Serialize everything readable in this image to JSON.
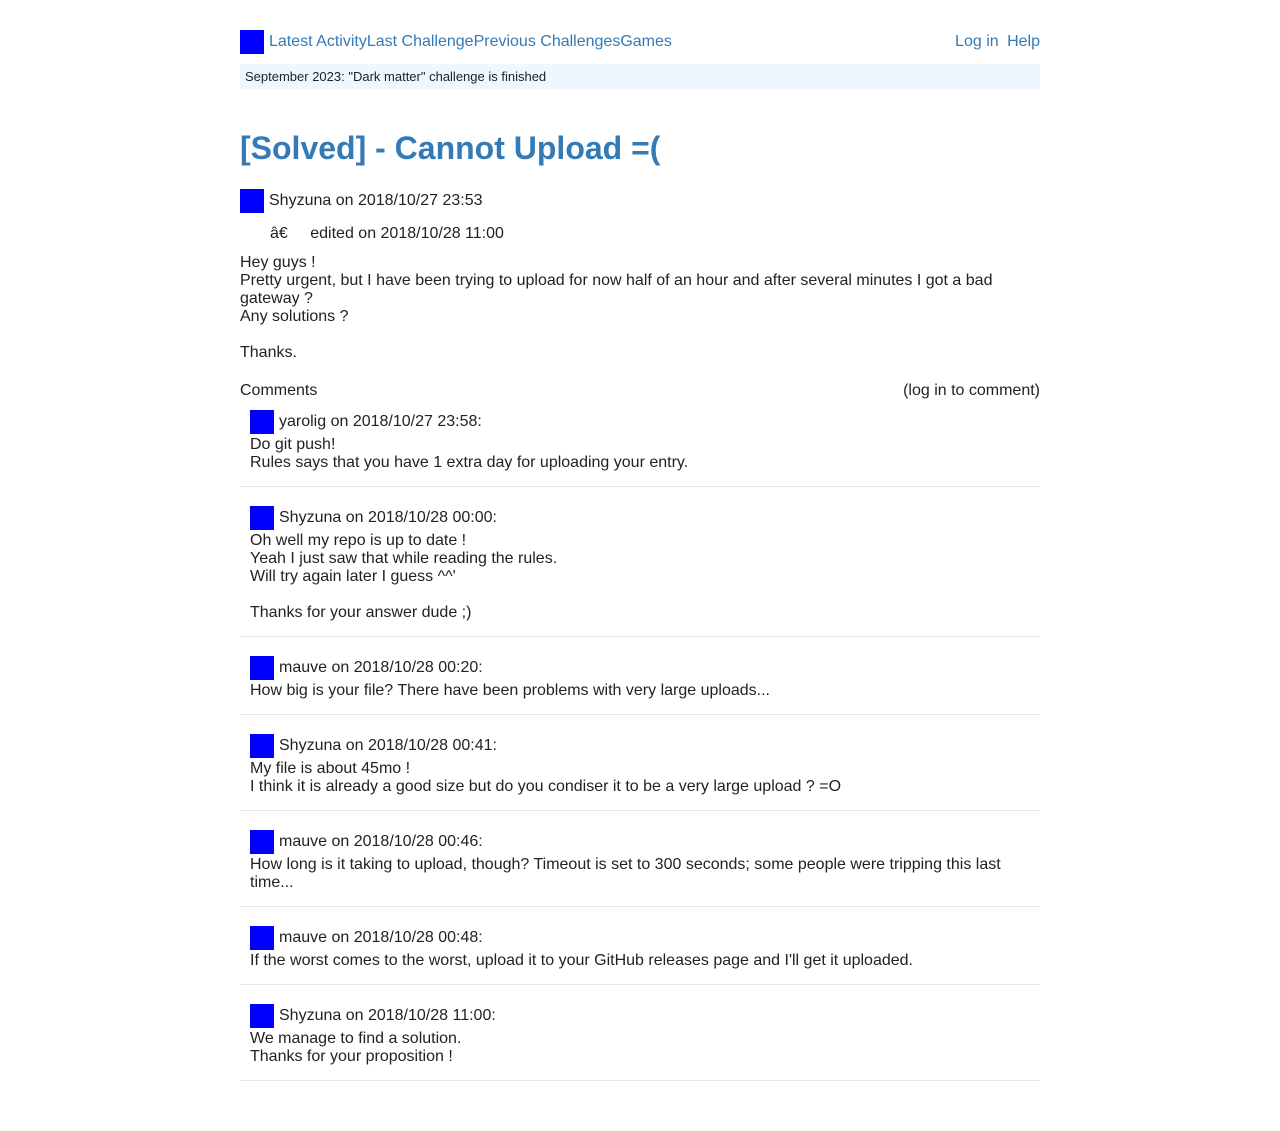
{
  "nav": {
    "links": [
      "Latest Activity",
      "Last Challenge",
      "Previous Challenges",
      "Games"
    ],
    "login": "Log in",
    "help": "Help"
  },
  "banner": "September 2023: \"Dark matter\" challenge is finished",
  "post": {
    "title": "[Solved] - Cannot Upload =(",
    "author": "Shyzuna",
    "date_text": "on 2018/10/27 23:53",
    "edit_glyph": "â€",
    "edited": "edited on 2018/10/28 11:00",
    "body": [
      "Hey guys !",
      "Pretty urgent, but I have been trying to upload for now half of an hour and after several minutes I got a bad gateway ?",
      "Any solutions ?",
      "",
      "Thanks."
    ]
  },
  "comments_section": {
    "label": "Comments",
    "login_prompt": "(log in to comment)"
  },
  "comments": [
    {
      "author": "yarolig",
      "date_text": "on 2018/10/27 23:58:",
      "lines": [
        "Do git push!",
        "Rules says that you have 1 extra day for uploading your entry."
      ]
    },
    {
      "author": "Shyzuna",
      "date_text": "on 2018/10/28 00:00:",
      "lines": [
        "Oh well my repo is up to date !",
        "Yeah I just saw that while reading the rules.",
        "Will try again later I guess ^^'",
        "",
        "Thanks for your answer dude ;)"
      ]
    },
    {
      "author": "mauve",
      "date_text": "on 2018/10/28 00:20:",
      "lines": [
        "How big is your file? There have been problems with very large uploads..."
      ]
    },
    {
      "author": "Shyzuna",
      "date_text": "on 2018/10/28 00:41:",
      "lines": [
        "My file is about 45mo !",
        "I think it is already a good size but do you condiser it to be a very large upload ? =O"
      ]
    },
    {
      "author": "mauve",
      "date_text": "on 2018/10/28 00:46:",
      "lines": [
        "How long is it taking to upload, though? Timeout is set to 300 seconds; some people were tripping this last time..."
      ]
    },
    {
      "author": "mauve",
      "date_text": "on 2018/10/28 00:48:",
      "lines": [
        "If the worst comes to the worst, upload it to your GitHub releases page and I'll get it uploaded."
      ]
    },
    {
      "author": "Shyzuna",
      "date_text": "on 2018/10/28 11:00:",
      "lines": [
        "We manage to find a solution.",
        "Thanks for your proposition !"
      ]
    }
  ]
}
